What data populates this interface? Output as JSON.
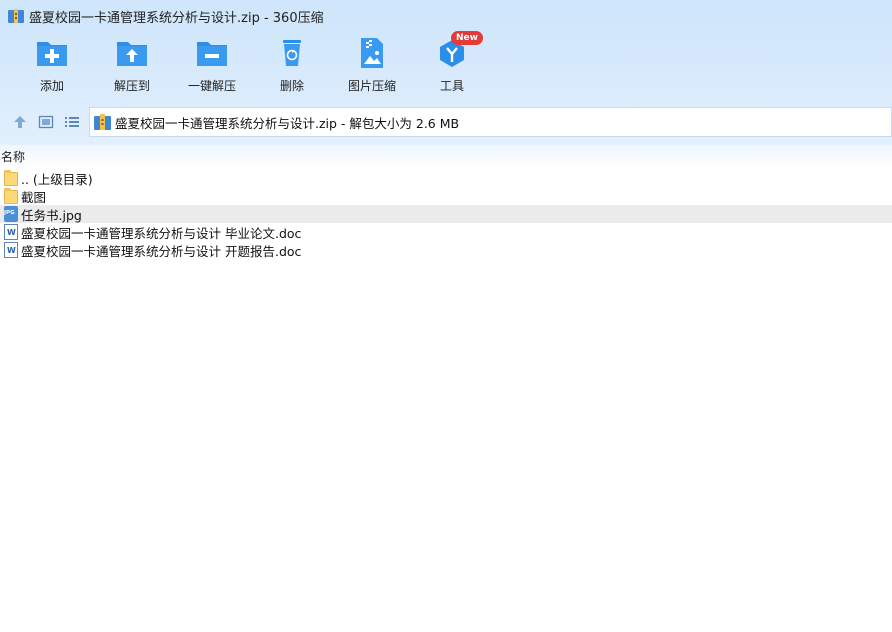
{
  "window": {
    "title": "盛夏校园一卡通管理系统分析与设计.zip - 360压缩"
  },
  "toolbar": {
    "items": [
      {
        "label": "添加",
        "icon": "add-icon"
      },
      {
        "label": "解压到",
        "icon": "extract-to-icon"
      },
      {
        "label": "一键解压",
        "icon": "one-click-extract-icon"
      },
      {
        "label": "删除",
        "icon": "delete-icon"
      },
      {
        "label": "图片压缩",
        "icon": "image-compress-icon"
      },
      {
        "label": "工具",
        "icon": "tools-icon",
        "badge": "New"
      }
    ]
  },
  "addressbar": {
    "path": "盛夏校园一卡通管理系统分析与设计.zip - 解包大小为 2.6 MB"
  },
  "filelist": {
    "column_name": "名称",
    "rows": [
      {
        "name": ".. (上级目录)",
        "icon": "folder-icon"
      },
      {
        "name": "截图",
        "icon": "folder-icon"
      },
      {
        "name": "任务书.jpg",
        "icon": "jpg-file-icon",
        "selected": true
      },
      {
        "name": "盛夏校园一卡通管理系统分析与设计 毕业论文.doc",
        "icon": "doc-file-icon"
      },
      {
        "name": "盛夏校园一卡通管理系统分析与设计 开题报告.doc",
        "icon": "doc-file-icon"
      }
    ]
  },
  "colors": {
    "accent": "#2b8ee8",
    "badge": "#e53a3a",
    "selected_row": "#ebebeb"
  }
}
